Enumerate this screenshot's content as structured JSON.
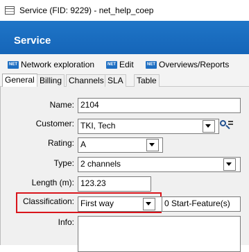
{
  "window": {
    "title": "Service (FID: 9229) - net_help_coep"
  },
  "banner": {
    "title": "Service"
  },
  "toolbar": {
    "icon_text": "NET",
    "items": [
      {
        "label": "Network exploration"
      },
      {
        "label": "Edit"
      },
      {
        "label": "Overviews/Reports"
      }
    ]
  },
  "tabs": [
    {
      "label": "General",
      "active": true
    },
    {
      "label": "Billing"
    },
    {
      "label": "Channels"
    },
    {
      "label": "SLA"
    },
    {
      "label": "Table"
    }
  ],
  "form": {
    "name": {
      "label": "Name:",
      "value": "2104"
    },
    "customer": {
      "label": "Customer:",
      "value": "TKI, Tech"
    },
    "rating": {
      "label": "Rating:",
      "value": "A"
    },
    "type": {
      "label": "Type:",
      "value": "2 channels"
    },
    "length": {
      "label": "Length (m):",
      "value": "123.23"
    },
    "classification": {
      "label": "Classification:",
      "value": "First way",
      "extra": "0 Start-Feature(s)"
    },
    "info": {
      "label": "Info:",
      "value": ""
    }
  },
  "colors": {
    "banner": "#1565b8",
    "highlight": "#d9141b"
  }
}
